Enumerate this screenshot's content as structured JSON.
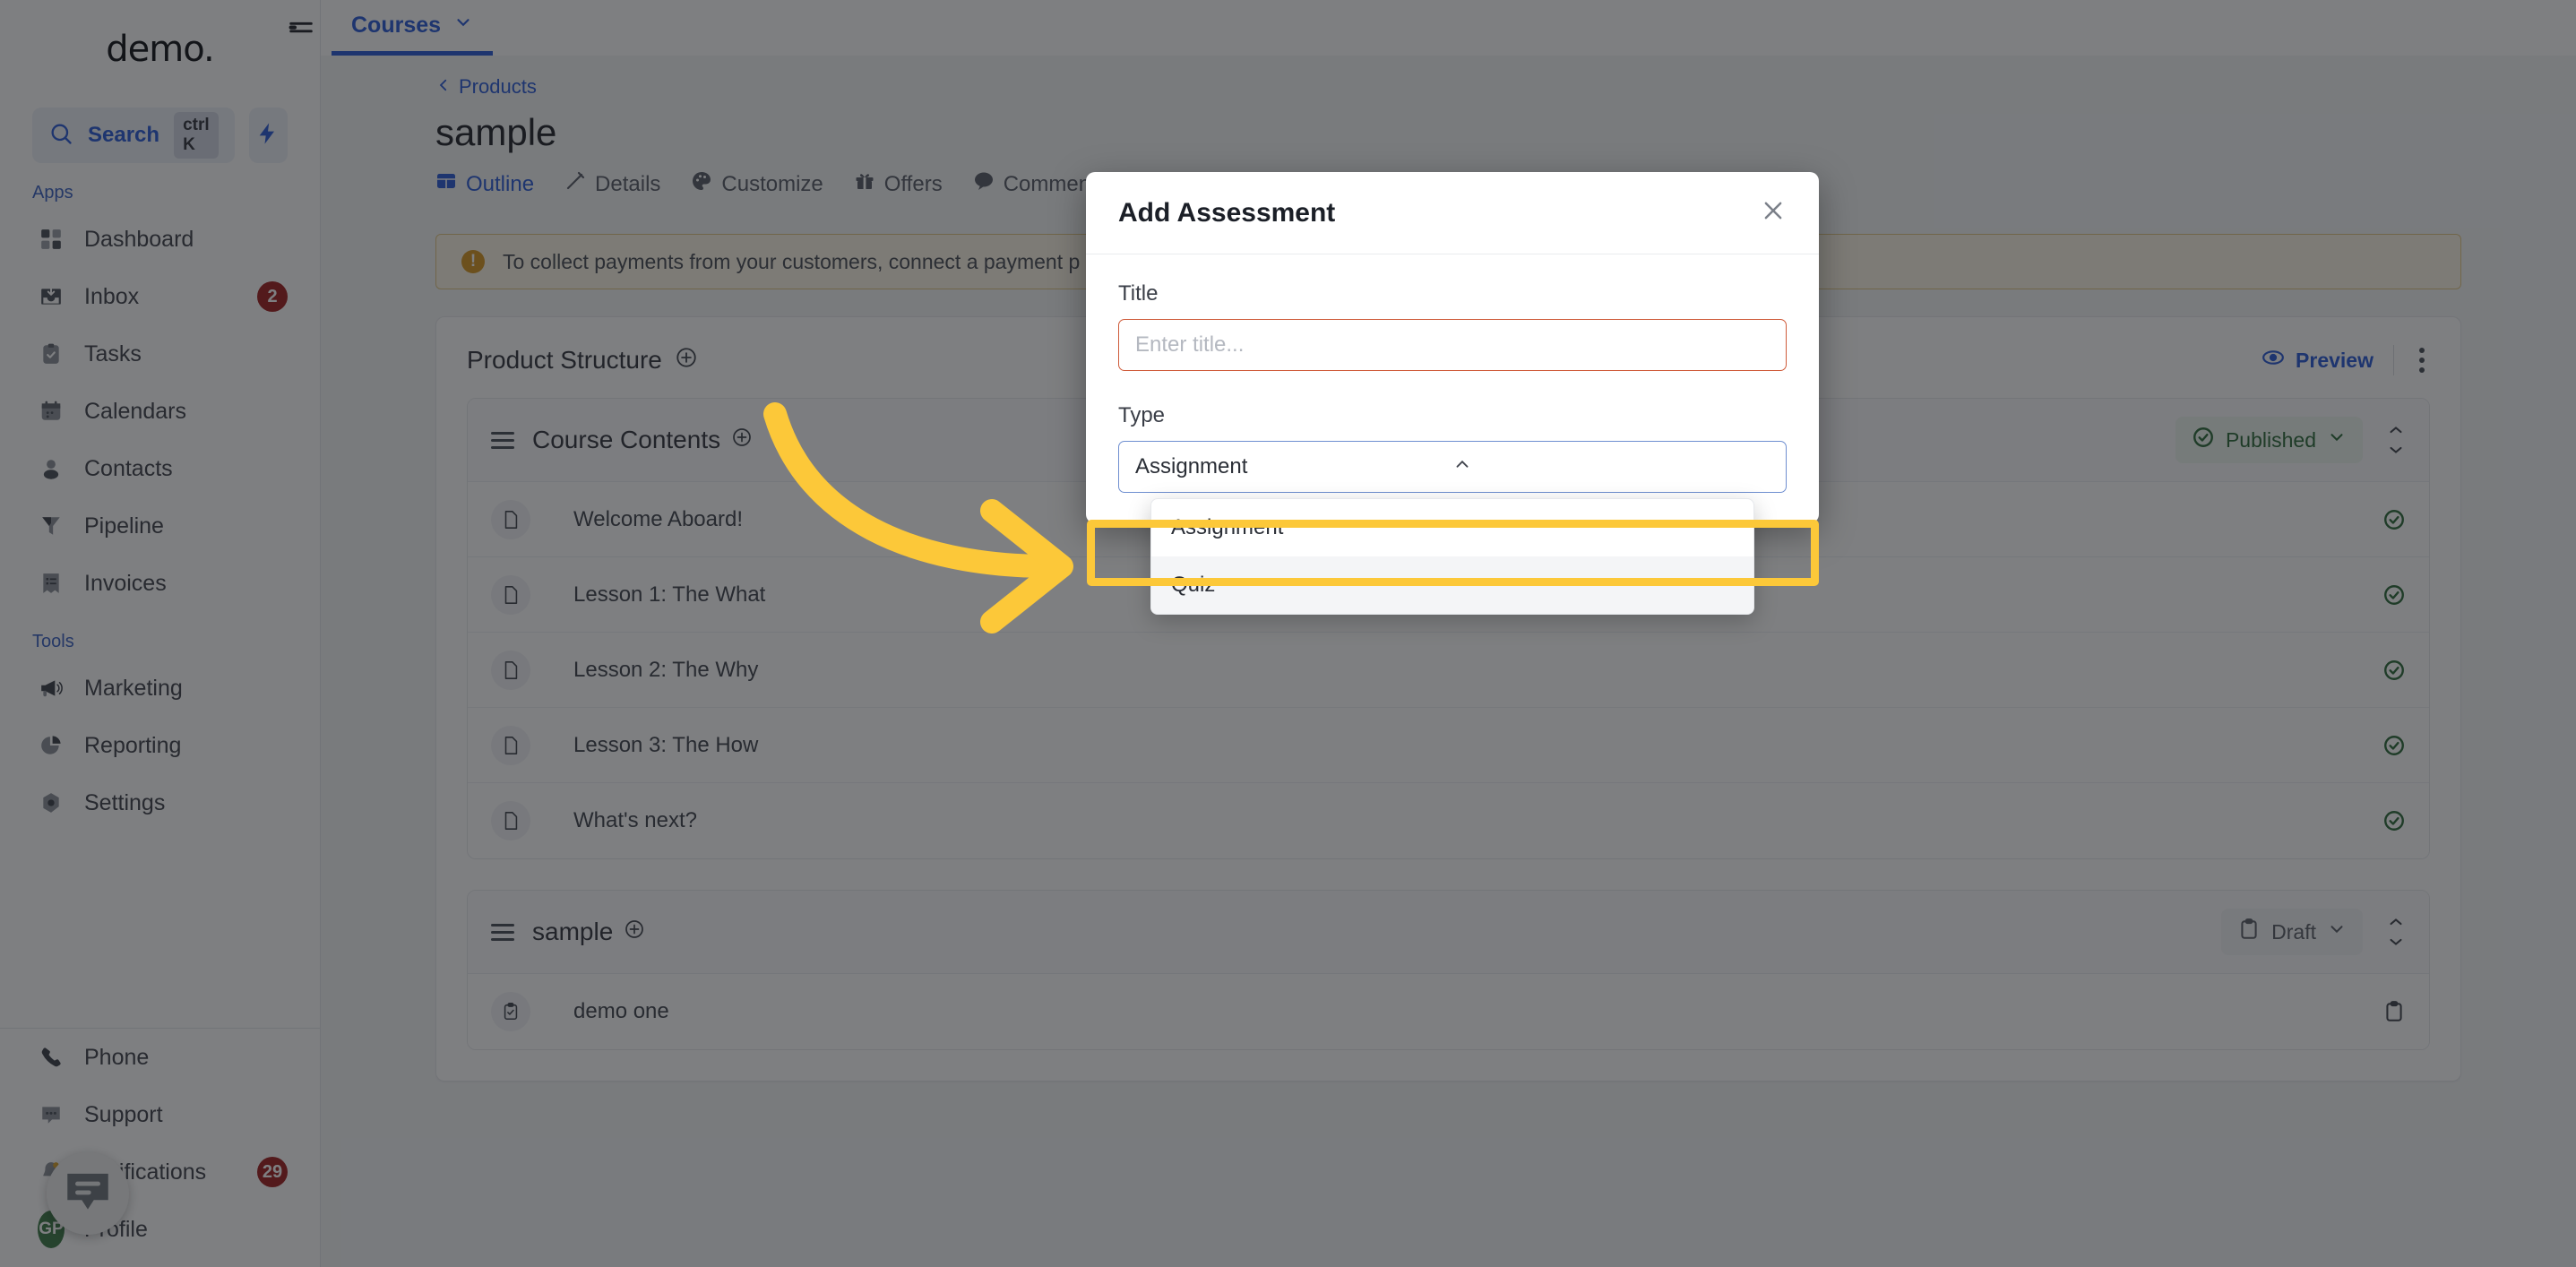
{
  "sidebar": {
    "logo": "demo.",
    "search": {
      "label": "Search",
      "shortcut": "ctrl K",
      "icon": "search-icon"
    },
    "bolt_icon": "bolt-icon",
    "sections": [
      {
        "label": "Apps",
        "items": [
          {
            "label": "Dashboard",
            "icon": "grid-icon",
            "badge": ""
          },
          {
            "label": "Inbox",
            "icon": "inbox-icon",
            "badge": "2"
          },
          {
            "label": "Tasks",
            "icon": "clipboard-check-icon",
            "badge": ""
          },
          {
            "label": "Calendars",
            "icon": "calendar-icon",
            "badge": ""
          },
          {
            "label": "Contacts",
            "icon": "user-icon",
            "badge": ""
          },
          {
            "label": "Pipeline",
            "icon": "funnel-icon",
            "badge": ""
          },
          {
            "label": "Invoices",
            "icon": "invoice-icon",
            "badge": ""
          }
        ]
      },
      {
        "label": "Tools",
        "items": [
          {
            "label": "Marketing",
            "icon": "megaphone-icon",
            "badge": ""
          },
          {
            "label": "Reporting",
            "icon": "pie-chart-icon",
            "badge": ""
          },
          {
            "label": "Settings",
            "icon": "gear-icon",
            "badge": ""
          }
        ]
      }
    ],
    "bottom_items": [
      {
        "label": "Phone",
        "icon": "phone-icon",
        "badge": ""
      },
      {
        "label": "Support",
        "icon": "chat-icon",
        "badge": ""
      },
      {
        "label": "Notifications",
        "icon": "bell-icon",
        "badge": "29"
      },
      {
        "label": "Profile",
        "icon": "avatar-icon",
        "avatar": "GP",
        "badge": ""
      }
    ],
    "chat_widget_icon": "chat-bubble-icon"
  },
  "topbar": {
    "hamburger_icon": "hamburger-icon",
    "tab": "Courses",
    "tab_chevron": "chevron-down-icon"
  },
  "page": {
    "breadcrumb": "Products",
    "breadcrumb_icon": "chevron-left-icon",
    "title": "sample",
    "tabs": [
      {
        "label": "Outline",
        "icon": "table-icon",
        "active": true
      },
      {
        "label": "Details",
        "icon": "pencil-icon",
        "active": false
      },
      {
        "label": "Customize",
        "icon": "palette-icon",
        "active": false
      },
      {
        "label": "Offers",
        "icon": "gift-icon",
        "active": false
      },
      {
        "label": "Comments",
        "icon": "comment-icon",
        "active": false
      }
    ],
    "alert": {
      "icon": "warning-icon",
      "text": "To collect payments from your customers, connect a payment p"
    },
    "panel": {
      "title": "Product Structure",
      "add_icon": "plus-circle-icon",
      "preview_label": "Preview",
      "preview_icon": "eye-icon",
      "kebab_icon": "kebab-menu-icon"
    },
    "modules": [
      {
        "title": "Course Contents",
        "add_icon": "plus-circle-icon",
        "status": "Published",
        "status_icon": "check-circle-icon",
        "status_type": "published",
        "rows": [
          {
            "name": "Welcome Aboard!",
            "icon": "document-icon",
            "status_icon": "check-circle-icon",
            "status_type": "published"
          },
          {
            "name": "Lesson 1: The What",
            "icon": "document-icon",
            "status_icon": "check-circle-icon",
            "status_type": "published"
          },
          {
            "name": "Lesson 2: The Why",
            "icon": "document-icon",
            "status_icon": "check-circle-icon",
            "status_type": "published"
          },
          {
            "name": "Lesson 3: The How",
            "icon": "document-icon",
            "status_icon": "check-circle-icon",
            "status_type": "published"
          },
          {
            "name": "What's next?",
            "icon": "document-icon",
            "status_icon": "check-circle-icon",
            "status_type": "published"
          }
        ]
      },
      {
        "title": "sample",
        "add_icon": "plus-circle-icon",
        "status": "Draft",
        "status_icon": "clipboard-icon",
        "status_type": "draft",
        "rows": [
          {
            "name": "demo one",
            "icon": "clipboard-check-icon",
            "status_icon": "clipboard-icon",
            "status_type": "draft"
          }
        ]
      }
    ]
  },
  "modal": {
    "title": "Add Assessment",
    "close_icon": "close-icon",
    "title_field": {
      "label": "Title",
      "value": "",
      "placeholder": "Enter title..."
    },
    "type_field": {
      "label": "Type",
      "selected": "Assignment",
      "chevron_icon": "chevron-up-icon",
      "options": [
        "Assignment",
        "Quiz"
      ],
      "highlighted_option": "Quiz"
    }
  },
  "annotation": {
    "arrow_color": "#fcc839",
    "highlight_color": "#fcc839",
    "arrow_icon": "curved-arrow-right-icon"
  }
}
